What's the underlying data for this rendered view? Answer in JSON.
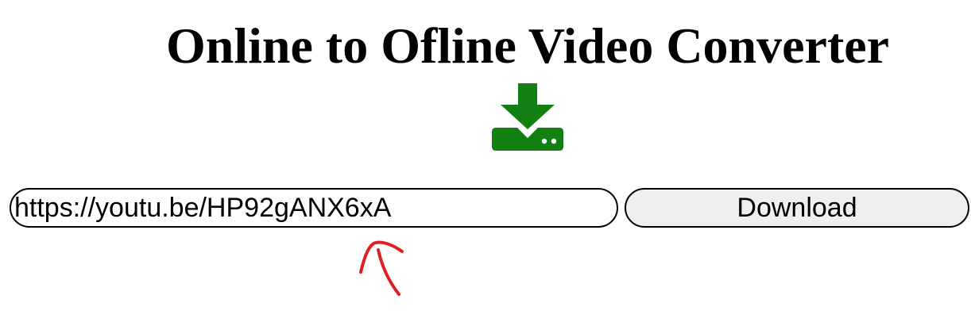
{
  "header": {
    "title": "Online to Ofline Video Converter"
  },
  "icons": {
    "download_icon": "download-to-drive-icon",
    "download_icon_color": "#128012"
  },
  "form": {
    "url_value": "https://youtu.be/HP92gANX6xA",
    "download_label": "Download"
  },
  "annotation": {
    "mark": "hand-drawn-arrow-up",
    "color": "#e02020"
  }
}
